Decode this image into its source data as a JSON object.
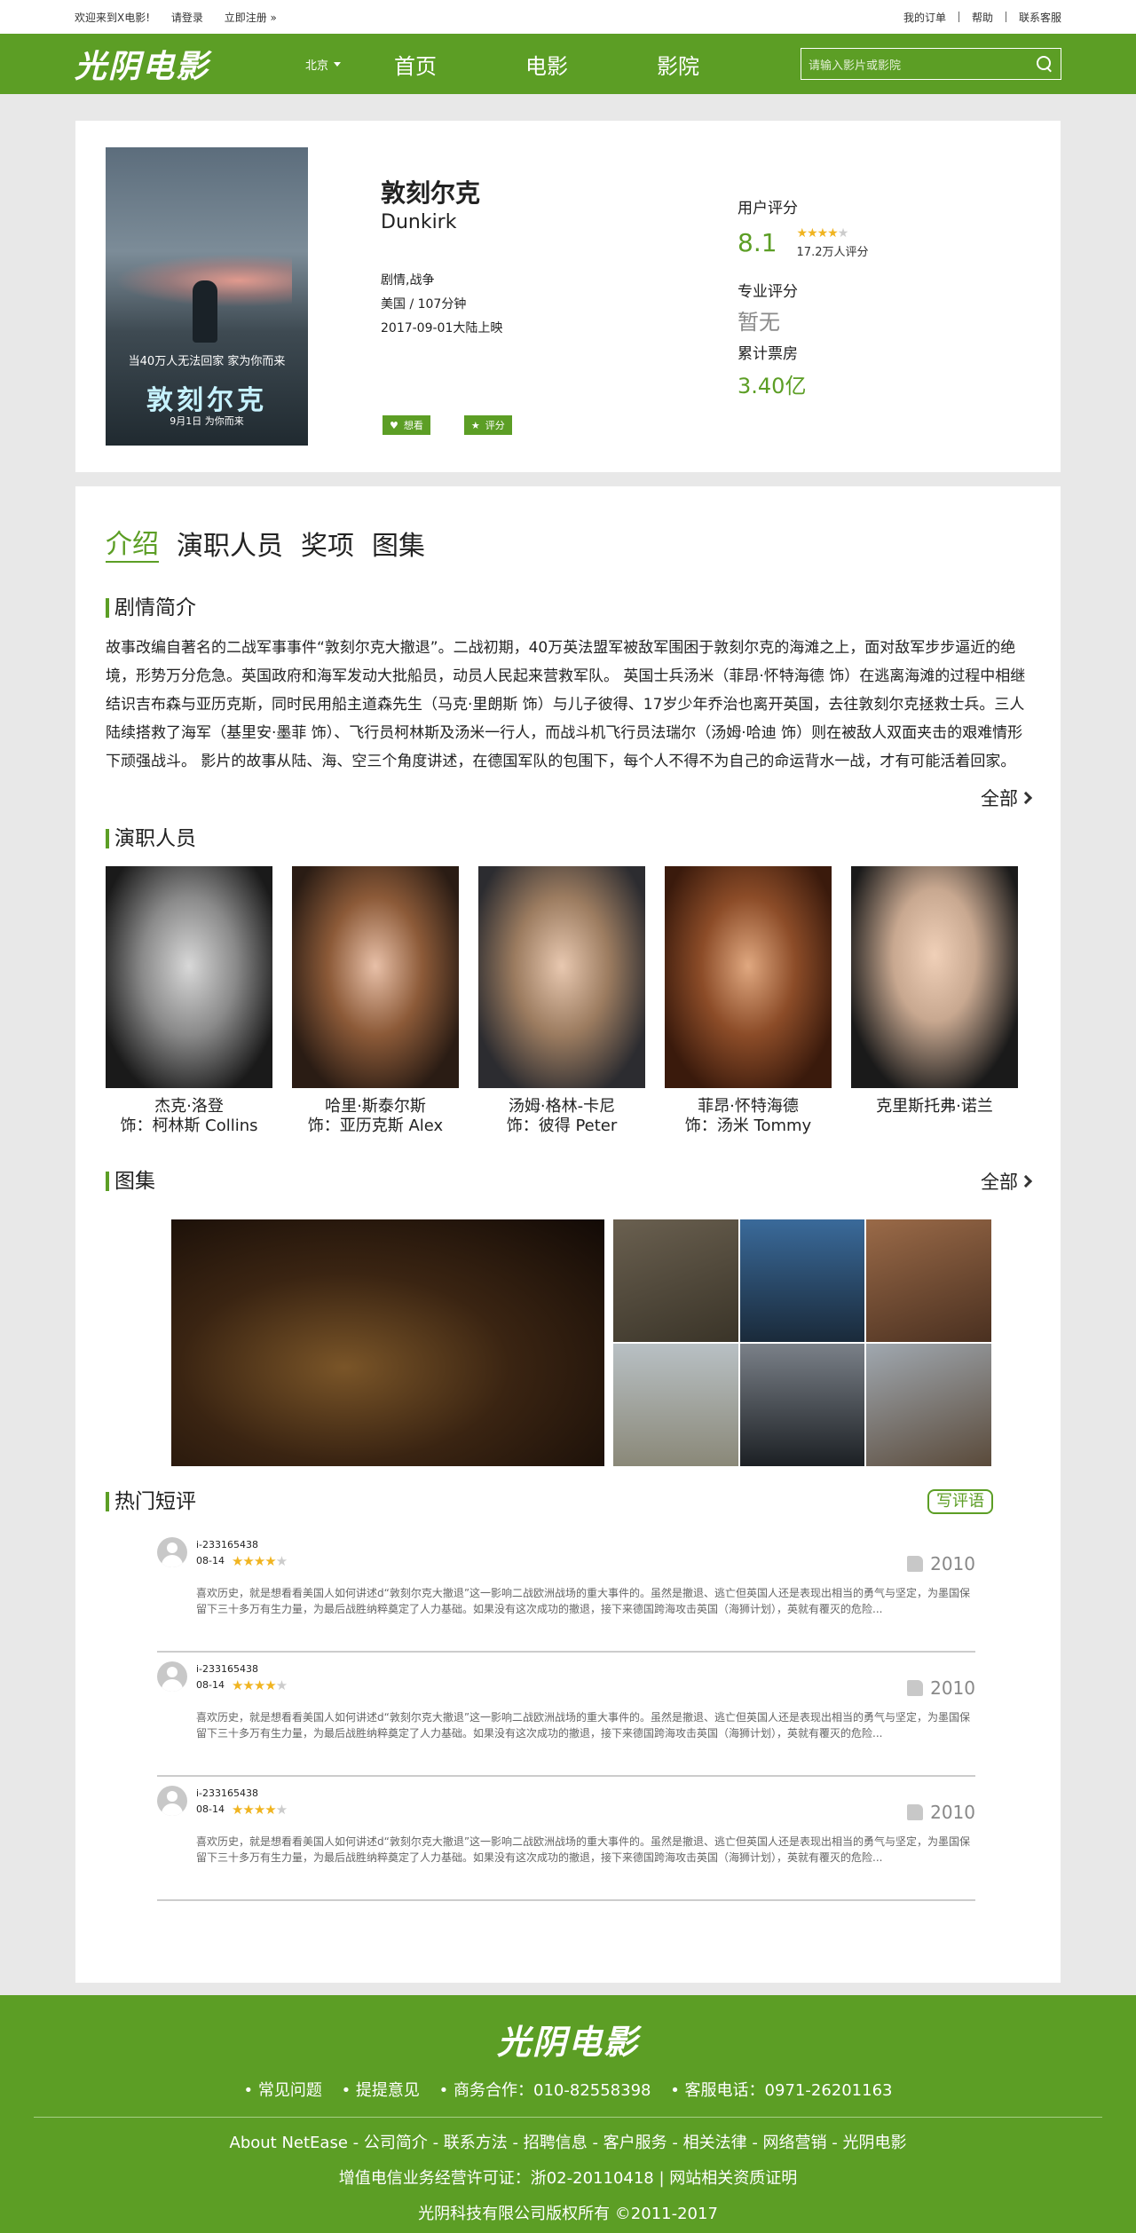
{
  "topbar": {
    "welcome": "欢迎来到X电影!",
    "login": "请登录",
    "register": "立即注册 »",
    "links": [
      "我的订单",
      "帮助",
      "联系客服"
    ]
  },
  "nav": {
    "logo": "光阴电影",
    "city": "北京",
    "items": [
      "首页",
      "电影",
      "影院"
    ],
    "search_placeholder": "请输入影片或影院"
  },
  "movie": {
    "poster": {
      "line1": "当40万人无法回家 家为你而来",
      "title": "敦刻尔克",
      "date": "9月1日 为你而来"
    },
    "title_cn": "敦刻尔克",
    "title_en": "Dunkirk",
    "genre": "剧情,战争",
    "region_duration": "美国 / 107分钟",
    "release": "2017-09-01大陆上映",
    "want_label": "想看",
    "rate_label": "评分",
    "user_score_label": "用户评分",
    "user_score": "8.1",
    "user_stars": 4,
    "rating_count": "17.2万人评分",
    "pro_score_label": "专业评分",
    "pro_score": "暂无",
    "box_office_label": "累计票房",
    "box_office": "3.40亿"
  },
  "tabs": [
    "介绍",
    "演职人员",
    "奖项",
    "图集"
  ],
  "plot": {
    "heading": "剧情简介",
    "text": "故事改编自著名的二战军事事件“敦刻尔克大撤退”。二战初期，40万英法盟军被敌军围困于敦刻尔克的海滩之上，面对敌军步步逼近的绝境，形势万分危急。英国政府和海军发动大批船员，动员人民起来营救军队。 英国士兵汤米（菲昂·怀特海德 饰）在逃离海滩的过程中相继结识吉布森与亚历克斯，同时民用船主道森先生（马克·里朗斯 饰）与儿子彼得、17岁少年乔治也离开英国，去往敦刻尔克拯救士兵。三人陆续搭救了海军（基里安·墨菲 饰）、飞行员柯林斯及汤米一行人，而战斗机飞行员法瑞尔（汤姆·哈迪 饰）则在被敌人双面夹击的艰难情形下顽强战斗。 影片的故事从陆、海、空三个角度讲述，在德国军队的包围下，每个人不得不为自己的命运背水一战，才有可能活着回家。",
    "more": "全部"
  },
  "cast": {
    "heading": "演职人员",
    "people": [
      {
        "name": "杰克·洛登",
        "role": "饰：柯林斯 Collins"
      },
      {
        "name": "哈里·斯泰尔斯",
        "role": "饰：亚历克斯 Alex"
      },
      {
        "name": "汤姆·格林-卡尼",
        "role": "饰：彼得 Peter"
      },
      {
        "name": "菲昂·怀特海德",
        "role": "饰：汤米 Tommy"
      },
      {
        "name": "克里斯托弗·诺兰",
        "role": ""
      }
    ]
  },
  "gallery": {
    "heading": "图集",
    "more": "全部"
  },
  "reviews": {
    "heading": "热门短评",
    "write": "写评语",
    "items": [
      {
        "user": "i-233165438",
        "date": "08-14",
        "stars": 4,
        "likes": "2010",
        "text": "喜欢历史，就是想看看美国人如何讲述d“敦刻尔克大撤退”这一影响二战欧洲战场的重大事件的。虽然是撤退、逃亡但英国人还是表现出相当的勇气与坚定，为墨国保留下三十多万有生力量，为最后战胜纳粹奠定了人力基础。如果没有这次成功的撤退，接下来德国跨海攻击英国（海狮计划），英就有覆灭的危险..."
      },
      {
        "user": "i-233165438",
        "date": "08-14",
        "stars": 4,
        "likes": "2010",
        "text": "喜欢历史，就是想看看美国人如何讲述d“敦刻尔克大撤退”这一影响二战欧洲战场的重大事件的。虽然是撤退、逃亡但英国人还是表现出相当的勇气与坚定，为墨国保留下三十多万有生力量，为最后战胜纳粹奠定了人力基础。如果没有这次成功的撤退，接下来德国跨海攻击英国（海狮计划），英就有覆灭的危险..."
      },
      {
        "user": "i-233165438",
        "date": "08-14",
        "stars": 4,
        "likes": "2010",
        "text": "喜欢历史，就是想看看美国人如何讲述d“敦刻尔克大撤退”这一影响二战欧洲战场的重大事件的。虽然是撤退、逃亡但英国人还是表现出相当的勇气与坚定，为墨国保留下三十多万有生力量，为最后战胜纳粹奠定了人力基础。如果没有这次成功的撤退，接下来德国跨海攻击英国（海狮计划），英就有覆灭的危险..."
      }
    ]
  },
  "footer": {
    "logo": "光阴电影",
    "links": [
      "• 常见问题",
      "• 提提意见",
      "• 商务合作：010-82558398",
      "• 客服电话：0971-26201163"
    ],
    "row": "About NetEase - 公司简介 - 联系方法 - 招聘信息 - 客户服务 - 相关法律 - 网络营销 - 光阴电影",
    "license": "增值电信业务经营许可证：浙02-20110418 | 网站相关资质证明",
    "copyright": "光阴科技有限公司版权所有 ©2011-2017"
  },
  "colors": {
    "brand": "#5c9e25",
    "star": "#f0b420"
  }
}
